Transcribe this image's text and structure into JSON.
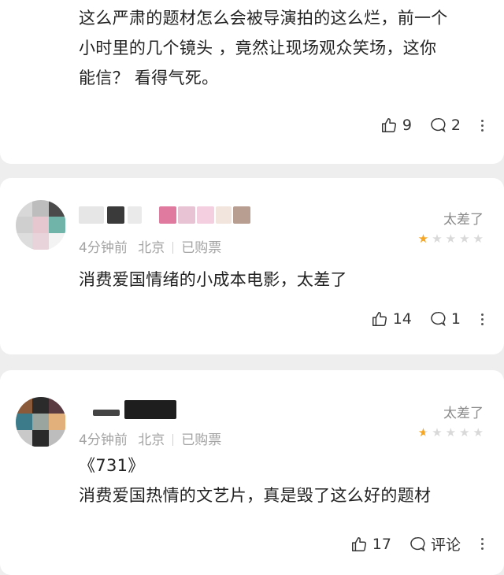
{
  "comments": [
    {
      "text_lines": [
        "这么严肃的题材怎么会被导演拍的这么烂，前一个",
        "小时里的几个镜头 ，竟然让现场观众笑场，这你",
        "能信？ 看得气死。"
      ],
      "likes": "9",
      "replies": "2"
    },
    {
      "rating_label": "太差了",
      "time": "4分钟前",
      "location": "北京",
      "purchase": "已购票",
      "stars_filled": 1,
      "stars_total": 5,
      "text_lines": [
        "消费爱国情绪的小成本电影，太差了"
      ],
      "likes": "14",
      "replies": "1"
    },
    {
      "rating_label": "太差了",
      "time": "4分钟前",
      "location": "北京",
      "purchase": "已购票",
      "stars_filled": 0.5,
      "stars_total": 5,
      "text_lines": [
        "《731》",
        "消费爱国热情的文艺片，真是毁了这么好的题材"
      ],
      "likes": "17",
      "replies": "评论"
    }
  ],
  "colors": {
    "star_on": "#f5a623",
    "star_off": "#d9d9d9",
    "meta": "#a3a3a3"
  },
  "icons": {
    "like": "thumbs-up-icon",
    "reply": "comment-bubble-icon",
    "more": "more-vertical-icon"
  }
}
